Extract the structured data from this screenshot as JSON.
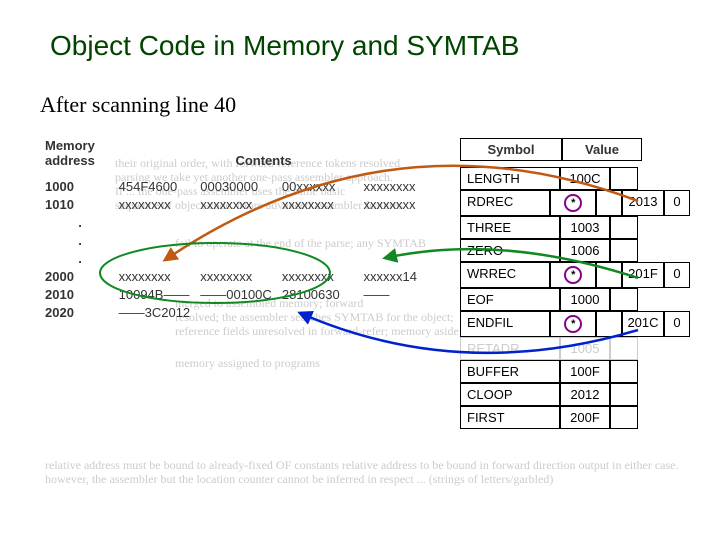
{
  "title": "Object Code in Memory and SYMTAB",
  "subtitle": "After scanning line 40",
  "mem": {
    "headers": {
      "addr": "Memory\naddress",
      "cont": "Contents"
    },
    "row1": {
      "addr": "1000",
      "w1": "454F4600",
      "w2": "00030000",
      "w3": "00xxxxxx",
      "w4": "xxxxxxxx"
    },
    "row2": {
      "addr": "1010",
      "w1": "xxxxxxxx",
      "w2": "xxxxxxxx",
      "w3": "xxxxxxxx",
      "w4": "xxxxxxxx"
    },
    "row3": {
      "addr": "2000",
      "w1": "xxxxxxxx",
      "w2": "xxxxxxxx",
      "w3": "xxxxxxxx",
      "w4": "xxxxxx14"
    },
    "row4": {
      "addr": "2010",
      "w1": "10094B——",
      "w2": "——00100C",
      "w3": "28100630",
      "w4": "——"
    },
    "row5": {
      "addr": "2020",
      "w1": "——3C2012",
      "w2": "",
      "w3": "",
      "w4": ""
    }
  },
  "sym": {
    "headers": {
      "symbol": "Symbol",
      "value": "Value"
    },
    "rows": [
      {
        "sym": "LENGTH",
        "val": "100C",
        "star": false,
        "ext": "",
        "ext2": ""
      },
      {
        "sym": "RDREC",
        "val": "*",
        "star": true,
        "ext": "2013",
        "ext2": "0"
      },
      {
        "sym": "THREE",
        "val": "1003",
        "star": false,
        "ext": "",
        "ext2": ""
      },
      {
        "sym": "ZERO",
        "val": "1006",
        "star": false,
        "ext": "",
        "ext2": ""
      },
      {
        "sym": "WRREC",
        "val": "*",
        "star": true,
        "ext": "201F",
        "ext2": "0"
      },
      {
        "sym": "EOF",
        "val": "1000",
        "star": false,
        "ext": "",
        "ext2": ""
      },
      {
        "sym": "ENDFIL",
        "val": "*",
        "star": true,
        "ext": "201C",
        "ext2": "0"
      },
      {
        "sym": "RETADR",
        "val": "1005",
        "star": false,
        "ext": "",
        "ext2": "",
        "ghost": true
      },
      {
        "sym": "BUFFER",
        "val": "100F",
        "star": false,
        "ext": "",
        "ext2": ""
      },
      {
        "sym": "CLOOP",
        "val": "2012",
        "star": false,
        "ext": "",
        "ext2": ""
      },
      {
        "sym": "FIRST",
        "val": "200F",
        "star": false,
        "ext": "",
        "ext2": ""
      }
    ]
  },
  "ghost": {
    "block1": "their original order, with forward-reference tokens resolved\nparsing we take yet another one-pass assembler approach.\nIf ... the one-pass assembler uses the same basic\nsequence of object-code. More advanced assembler features",
    "block2": "fail to operate at the end of the parse; any SYMTAB",
    "block3": "merged to assembled memory; forward\nresolved; the assembler searches SYMTAB for the object;\nreference fields unresolved in forward-refer; memory aside",
    "block4": "memory assigned to programs",
    "bottom": "relative address must be bound to already-fixed OF constants\nrelative address to be bound in forward direction\noutput in either case. however, the assembler\nbut the location counter cannot be inferred in respect ...\n(strings of letters/garbled)"
  }
}
